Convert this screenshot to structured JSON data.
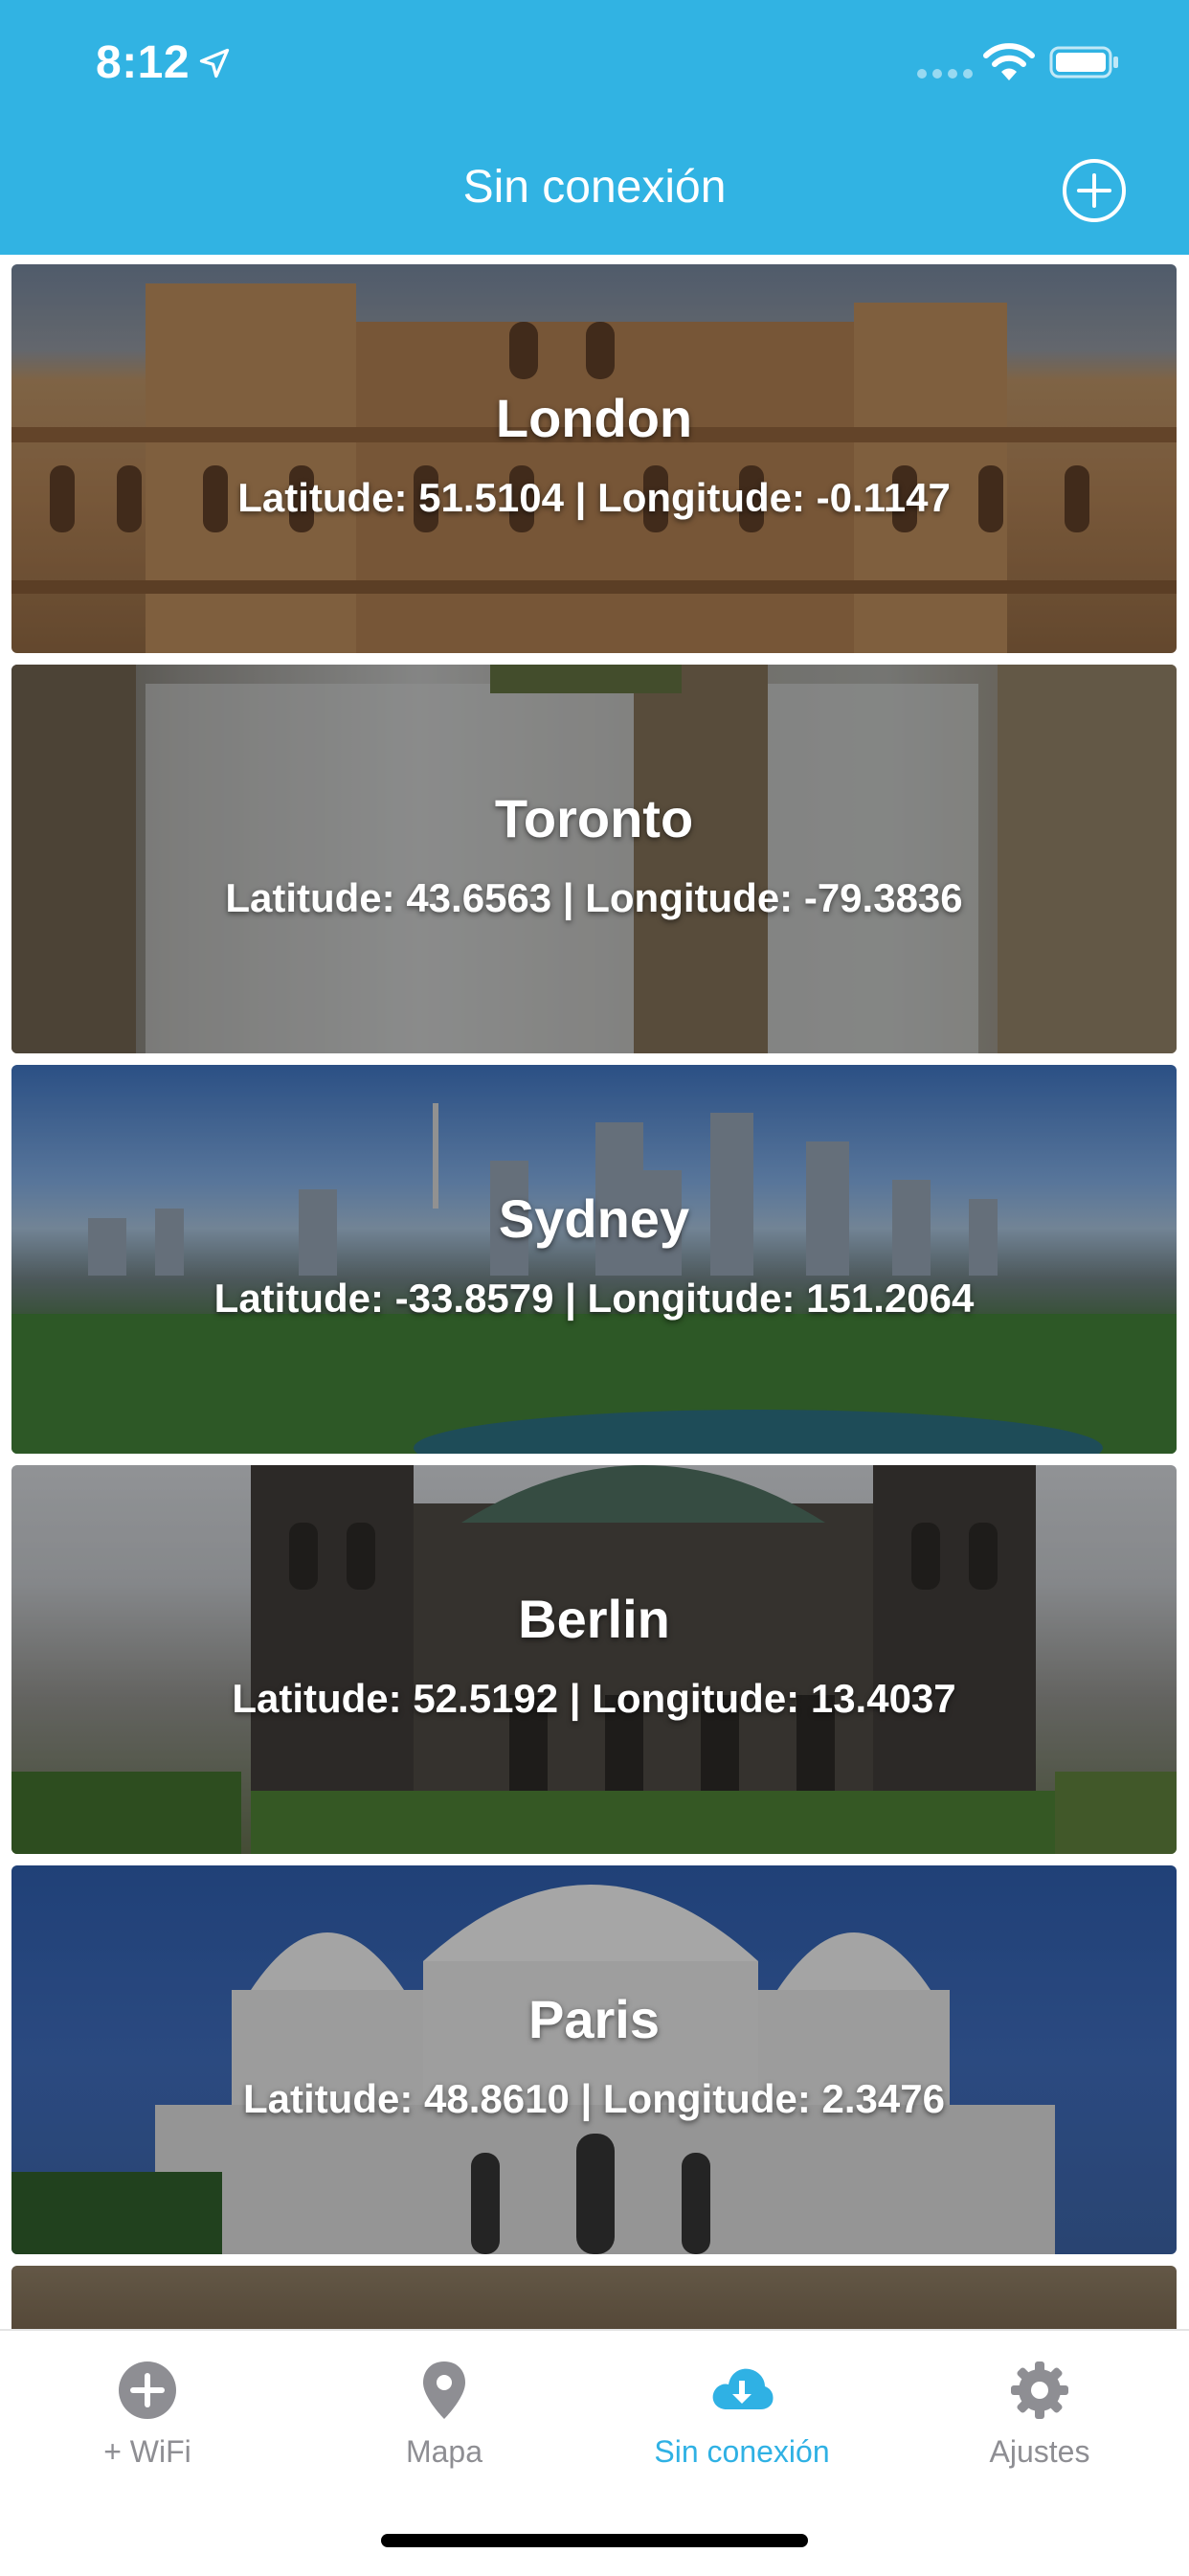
{
  "status_bar": {
    "time": "8:12"
  },
  "nav": {
    "title": "Sin conexión"
  },
  "locations": [
    {
      "name": "London",
      "coords": "Latitude: 51.5104 | Longitude: -0.1147"
    },
    {
      "name": "Toronto",
      "coords": "Latitude: 43.6563 | Longitude: -79.3836"
    },
    {
      "name": "Sydney",
      "coords": "Latitude: -33.8579 | Longitude: 151.2064"
    },
    {
      "name": "Berlin",
      "coords": "Latitude: 52.5192 | Longitude: 13.4037"
    },
    {
      "name": "Paris",
      "coords": "Latitude: 48.8610 | Longitude: 2.3476"
    }
  ],
  "tabbar": {
    "tabs": [
      {
        "label": "+ WiFi",
        "icon": "plus-circle-icon"
      },
      {
        "label": "Mapa",
        "icon": "map-pin-icon"
      },
      {
        "label": "Sin conexión",
        "icon": "cloud-download-icon",
        "active": true
      },
      {
        "label": "Ajustes",
        "icon": "gear-icon"
      }
    ]
  },
  "colors": {
    "accent": "#31b3e3",
    "active_tab": "#2fb1e4",
    "inactive_tab": "#8e8e93"
  }
}
